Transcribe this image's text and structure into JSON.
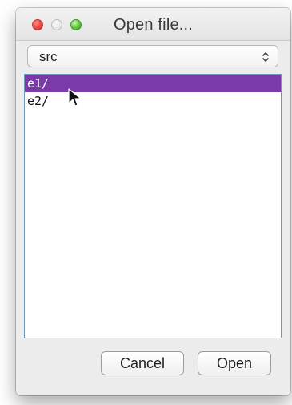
{
  "window": {
    "title": "Open file...",
    "traffic_lights": [
      {
        "name": "close",
        "color": "#e0443e"
      },
      {
        "name": "minimize",
        "color": "#dcdcdc"
      },
      {
        "name": "zoom",
        "color": "#59c036"
      }
    ]
  },
  "location": {
    "selected": "src",
    "icon": "up-down-chevron-icon"
  },
  "files": [
    {
      "name": "e1/",
      "selected": true
    },
    {
      "name": "e2/",
      "selected": false
    }
  ],
  "buttons": {
    "cancel": "Cancel",
    "open": "Open"
  },
  "colors": {
    "selection": "#7b3aa9",
    "list_border": "#6f97b8",
    "window_bg": "#ececec"
  },
  "cursor": {
    "icon": "arrow-cursor-icon"
  }
}
